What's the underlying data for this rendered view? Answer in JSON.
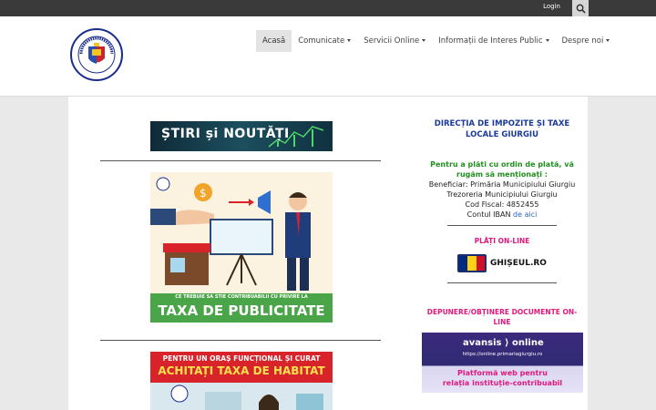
{
  "topbar": {
    "login_label": "Login"
  },
  "nav": [
    {
      "label": "Acasă",
      "dropdown": false
    },
    {
      "label": "Comunicate",
      "dropdown": true
    },
    {
      "label": "Servicii Online",
      "dropdown": true
    },
    {
      "label": "Informații de Interes Public",
      "dropdown": true
    },
    {
      "label": "Despre noi",
      "dropdown": true
    }
  ],
  "banner": {
    "stiri_text": "ȘTIRI și NOUTĂȚI"
  },
  "poster1": {
    "caption_small": "CE TREBUIE SA STIE CONTRIBUABILII CU PRIVIRE LA",
    "caption_big": "TAXA DE PUBLICITATE"
  },
  "poster2": {
    "line1": "PENTRU UN ORAȘ FUNCȚIONAL ȘI CURAT",
    "line2": "ACHITAȚI TAXA DE HABITAT"
  },
  "sidebar": {
    "title_line1": "DIRECȚIA DE IMPOZITE ȘI TAXE",
    "title_line2": "LOCALE GIURGIU",
    "green_line1": "Pentru a plăti cu ordin de plată, vă",
    "green_line2": "rugăm să menționați :",
    "beneficiar": "Beneficiar: Primăria Municipiului Giurgiu",
    "trezoreria": "Trezoreria Municipiului Giurgiu",
    "cod_fiscal": "Cod Fiscal: 4852455",
    "iban_prefix": "Contul IBAN",
    "iban_link": "de aici",
    "plati_title": "PLĂȚI ON-LINE",
    "ghiseul_label": "GHIȘEUL.RO",
    "depunere_line1": "DEPUNERE/OBȚINERE DOCUMENTE ON-",
    "depunere_line2": "LINE",
    "avansis": {
      "logo": "avansis ⟩ online",
      "url": "https://online.primariagiurgiu.ro",
      "line1": "Platformă web pentru",
      "line2": "relația instituție-contribuabil"
    }
  },
  "colors": {
    "topbar": "#3a3a3a",
    "accent_pink": "#e0197d",
    "title_blue": "#1a3a9a",
    "green": "#1f8f1f",
    "flag": [
      "#002b7f",
      "#fcd116",
      "#ce1126"
    ]
  }
}
